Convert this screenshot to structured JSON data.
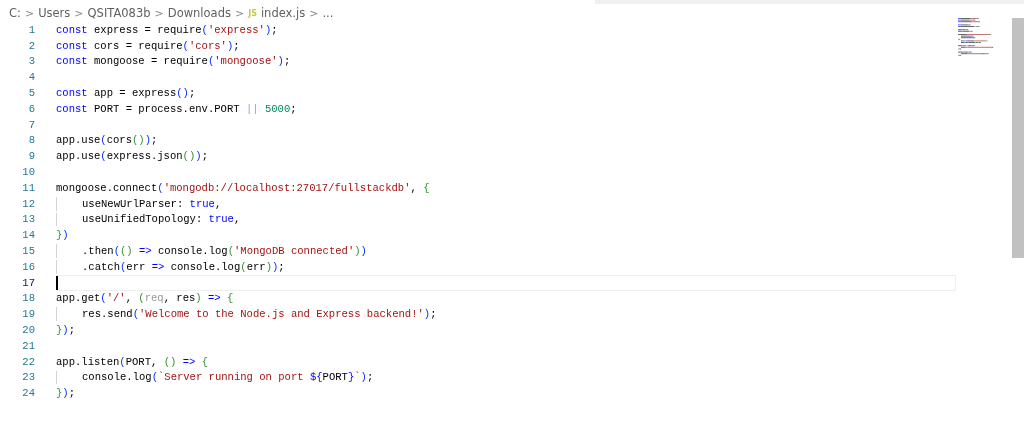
{
  "breadcrumb": [
    {
      "kind": "text",
      "text": "C:"
    },
    {
      "kind": "sep",
      "text": ">"
    },
    {
      "kind": "text",
      "text": "Users"
    },
    {
      "kind": "sep",
      "text": ">"
    },
    {
      "kind": "text",
      "text": "QSITA083b"
    },
    {
      "kind": "sep",
      "text": ">"
    },
    {
      "kind": "text",
      "text": "Downloads"
    },
    {
      "kind": "sep",
      "text": ">"
    },
    {
      "kind": "file",
      "badge": "JS",
      "text": "index.js"
    },
    {
      "kind": "sep",
      "text": ">"
    },
    {
      "kind": "text",
      "text": "..."
    }
  ],
  "lines": [
    {
      "number": "1",
      "indent": false,
      "current": false,
      "tokens": [
        {
          "kind": "kw",
          "text": "const"
        },
        {
          "kind": "t",
          "text": " express = require"
        },
        {
          "kind": "b1",
          "text": "("
        },
        {
          "kind": "s",
          "text": "'express'"
        },
        {
          "kind": "b1",
          "text": ")"
        },
        {
          "kind": "t",
          "text": ";"
        }
      ]
    },
    {
      "number": "2",
      "indent": false,
      "current": false,
      "tokens": [
        {
          "kind": "kw",
          "text": "const"
        },
        {
          "kind": "t",
          "text": " cors = require"
        },
        {
          "kind": "b1",
          "text": "("
        },
        {
          "kind": "s",
          "text": "'cors'"
        },
        {
          "kind": "b1",
          "text": ")"
        },
        {
          "kind": "t",
          "text": ";"
        }
      ]
    },
    {
      "number": "3",
      "indent": false,
      "current": false,
      "tokens": [
        {
          "kind": "kw",
          "text": "const"
        },
        {
          "kind": "t",
          "text": " mongoose = require"
        },
        {
          "kind": "b1",
          "text": "("
        },
        {
          "kind": "s",
          "text": "'mongoose'"
        },
        {
          "kind": "b1",
          "text": ")"
        },
        {
          "kind": "t",
          "text": ";"
        }
      ]
    },
    {
      "number": "4",
      "indent": false,
      "current": false
    },
    {
      "number": "5",
      "indent": false,
      "current": false,
      "tokens": [
        {
          "kind": "kw",
          "text": "const"
        },
        {
          "kind": "t",
          "text": " app = express"
        },
        {
          "kind": "b1",
          "text": "()"
        },
        {
          "kind": "t",
          "text": ";"
        }
      ]
    },
    {
      "number": "6",
      "indent": false,
      "current": false,
      "tokens": [
        {
          "kind": "kw",
          "text": "const"
        },
        {
          "kind": "t",
          "text": " PORT = process.env.PORT "
        },
        {
          "kind": "op",
          "text": "||"
        },
        {
          "kind": "n",
          "text": " 5000"
        },
        {
          "kind": "t",
          "text": ";"
        }
      ]
    },
    {
      "number": "7",
      "indent": false,
      "current": false
    },
    {
      "number": "8",
      "indent": false,
      "current": false,
      "tokens": [
        {
          "kind": "t",
          "text": "app.use"
        },
        {
          "kind": "b1",
          "text": "("
        },
        {
          "kind": "t",
          "text": "cors"
        },
        {
          "kind": "b2",
          "text": "()"
        },
        {
          "kind": "b1",
          "text": ")"
        },
        {
          "kind": "t",
          "text": ";"
        }
      ]
    },
    {
      "number": "9",
      "indent": false,
      "current": false,
      "tokens": [
        {
          "kind": "t",
          "text": "app.use"
        },
        {
          "kind": "b1",
          "text": "("
        },
        {
          "kind": "t",
          "text": "express.json"
        },
        {
          "kind": "b2",
          "text": "()"
        },
        {
          "kind": "b1",
          "text": ")"
        },
        {
          "kind": "t",
          "text": ";"
        }
      ]
    },
    {
      "number": "10",
      "indent": false,
      "current": false
    },
    {
      "number": "11",
      "indent": false,
      "current": false,
      "tokens": [
        {
          "kind": "t",
          "text": "mongoose.connect"
        },
        {
          "kind": "b1",
          "text": "("
        },
        {
          "kind": "s",
          "text": "'mongodb://localhost:27017/fullstackdb'"
        },
        {
          "kind": "t",
          "text": ", "
        },
        {
          "kind": "b2",
          "text": "{"
        }
      ]
    },
    {
      "number": "12",
      "indent": true,
      "current": false,
      "tokens": [
        {
          "kind": "t",
          "text": "useNewUrlParser: "
        },
        {
          "kind": "kw",
          "text": "true"
        },
        {
          "kind": "t",
          "text": ","
        }
      ]
    },
    {
      "number": "13",
      "indent": true,
      "current": false,
      "tokens": [
        {
          "kind": "t",
          "text": "useUnifiedTopology: "
        },
        {
          "kind": "kw",
          "text": "true"
        },
        {
          "kind": "t",
          "text": ","
        }
      ]
    },
    {
      "number": "14",
      "indent": false,
      "current": false,
      "tokens": [
        {
          "kind": "b2",
          "text": "}"
        },
        {
          "kind": "b1",
          "text": ")"
        }
      ]
    },
    {
      "number": "15",
      "indent": true,
      "current": false,
      "tokens": [
        {
          "kind": "t",
          "text": ".then"
        },
        {
          "kind": "b1",
          "text": "("
        },
        {
          "kind": "b2",
          "text": "()"
        },
        {
          "kind": "kw",
          "text": " =>"
        },
        {
          "kind": "t",
          "text": " console.log"
        },
        {
          "kind": "b2",
          "text": "("
        },
        {
          "kind": "s",
          "text": "'MongoDB connected'"
        },
        {
          "kind": "b2",
          "text": ")"
        },
        {
          "kind": "b1",
          "text": ")"
        }
      ]
    },
    {
      "number": "16",
      "indent": true,
      "current": false,
      "tokens": [
        {
          "kind": "t",
          "text": ".catch"
        },
        {
          "kind": "b1",
          "text": "("
        },
        {
          "kind": "t",
          "text": "err "
        },
        {
          "kind": "kw",
          "text": "=>"
        },
        {
          "kind": "t",
          "text": " console.log"
        },
        {
          "kind": "b2",
          "text": "("
        },
        {
          "kind": "t",
          "text": "err"
        },
        {
          "kind": "b2",
          "text": ")"
        },
        {
          "kind": "b1",
          "text": ")"
        },
        {
          "kind": "t",
          "text": ";"
        }
      ]
    },
    {
      "number": "17",
      "indent": false,
      "current": true
    },
    {
      "number": "18",
      "indent": false,
      "current": false,
      "tokens": [
        {
          "kind": "t",
          "text": "app.get"
        },
        {
          "kind": "b1",
          "text": "("
        },
        {
          "kind": "s",
          "text": "'/'"
        },
        {
          "kind": "t",
          "text": ", "
        },
        {
          "kind": "b2",
          "text": "("
        },
        {
          "kind": "m",
          "text": "req"
        },
        {
          "kind": "t",
          "text": ", res"
        },
        {
          "kind": "b2",
          "text": ")"
        },
        {
          "kind": "kw",
          "text": " => "
        },
        {
          "kind": "b2",
          "text": "{"
        }
      ]
    },
    {
      "number": "19",
      "indent": true,
      "current": false,
      "tokens": [
        {
          "kind": "t",
          "text": "res.send"
        },
        {
          "kind": "b1",
          "text": "("
        },
        {
          "kind": "s",
          "text": "'Welcome to the Node.js and Express backend!'"
        },
        {
          "kind": "b1",
          "text": ")"
        },
        {
          "kind": "t",
          "text": ";"
        }
      ]
    },
    {
      "number": "20",
      "indent": false,
      "current": false,
      "tokens": [
        {
          "kind": "b2",
          "text": "}"
        },
        {
          "kind": "b1",
          "text": ")"
        },
        {
          "kind": "t",
          "text": ";"
        }
      ]
    },
    {
      "number": "21",
      "indent": false,
      "current": false
    },
    {
      "number": "22",
      "indent": false,
      "current": false,
      "tokens": [
        {
          "kind": "t",
          "text": "app.listen"
        },
        {
          "kind": "b1",
          "text": "("
        },
        {
          "kind": "t",
          "text": "PORT, "
        },
        {
          "kind": "b2",
          "text": "()"
        },
        {
          "kind": "kw",
          "text": " => "
        },
        {
          "kind": "b2",
          "text": "{"
        }
      ]
    },
    {
      "number": "23",
      "indent": true,
      "current": false,
      "tokens": [
        {
          "kind": "t",
          "text": "console.log"
        },
        {
          "kind": "b1",
          "text": "("
        },
        {
          "kind": "s",
          "text": "`Server running on port "
        },
        {
          "kind": "kw",
          "text": "${"
        },
        {
          "kind": "t",
          "text": "PORT"
        },
        {
          "kind": "kw",
          "text": "}"
        },
        {
          "kind": "s",
          "text": "`"
        },
        {
          "kind": "b1",
          "text": ")"
        },
        {
          "kind": "t",
          "text": ";"
        }
      ]
    },
    {
      "number": "24",
      "indent": false,
      "current": false,
      "tokens": [
        {
          "kind": "b2",
          "text": "}"
        },
        {
          "kind": "b1",
          "text": ")"
        },
        {
          "kind": "t",
          "text": ";"
        }
      ]
    }
  ]
}
